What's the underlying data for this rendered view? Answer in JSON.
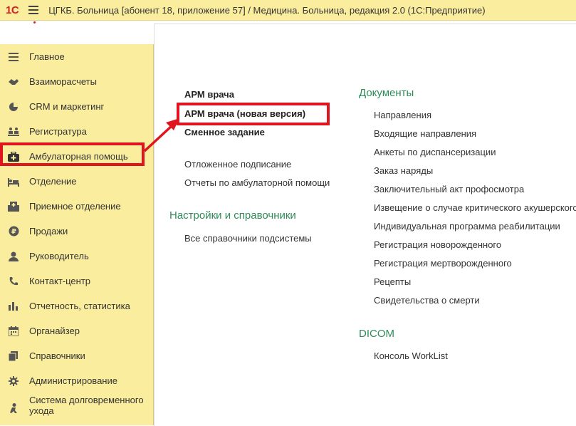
{
  "window": {
    "logo": "1С",
    "title": "ЦГКБ. Больница [абонент 18, приложение 57] / Медицина. Больница, редакция 2.0  (1С:Предприятие)"
  },
  "sidebar": {
    "items": [
      {
        "label": "Главное",
        "icon": "menu-lines-icon"
      },
      {
        "label": "Взаиморасчеты",
        "icon": "handshake-icon"
      },
      {
        "label": "CRM и маркетинг",
        "icon": "pie-chart-icon"
      },
      {
        "label": "Регистратура",
        "icon": "people-desk-icon"
      },
      {
        "label": "Амбулаторная помощь",
        "icon": "medical-bag-icon"
      },
      {
        "label": "Отделение",
        "icon": "bed-icon"
      },
      {
        "label": "Приемное отделение",
        "icon": "building-icon"
      },
      {
        "label": "Продажи",
        "icon": "ruble-coin-icon"
      },
      {
        "label": "Руководитель",
        "icon": "user-icon"
      },
      {
        "label": "Контакт-центр",
        "icon": "phone-icon"
      },
      {
        "label": "Отчетность, статистика",
        "icon": "bar-chart-icon"
      },
      {
        "label": "Органайзер",
        "icon": "calendar-icon"
      },
      {
        "label": "Справочники",
        "icon": "books-icon"
      },
      {
        "label": "Администрирование",
        "icon": "gear-icon"
      },
      {
        "label": "Система долговременного ухода",
        "icon": "care-person-icon"
      }
    ],
    "selected": "Амбулаторная помощь"
  },
  "main": {
    "left_links": {
      "arm_vracha": "АРМ врача",
      "arm_vracha_new": "АРМ врача (новая версия)",
      "smennoe": "Сменное задание",
      "otlozhennoe": "Отложенное подписание",
      "otchety": "Отчеты по амбулаторной помощи"
    },
    "settings": {
      "title": "Настройки и справочники",
      "link": "Все справочники подсистемы"
    },
    "documents": {
      "title": "Документы",
      "items": [
        "Направления",
        "Входящие направления",
        "Анкеты по диспансеризации",
        "Заказ наряды",
        "Заключительный акт профосмотра",
        "Извещение о случае критического акушерского",
        "Индивидуальная программа реабилитации",
        "Регистрация новорожденного",
        "Регистрация мертворожденного",
        "Рецепты",
        "Свидетельства о смерти"
      ]
    },
    "dicom": {
      "title": "DICOM",
      "link": "Консоль WorkList"
    }
  },
  "colors": {
    "sidebar_bg": "#fbed9e",
    "section_title": "#2e8b57",
    "annotation_red": "#e0141e"
  }
}
